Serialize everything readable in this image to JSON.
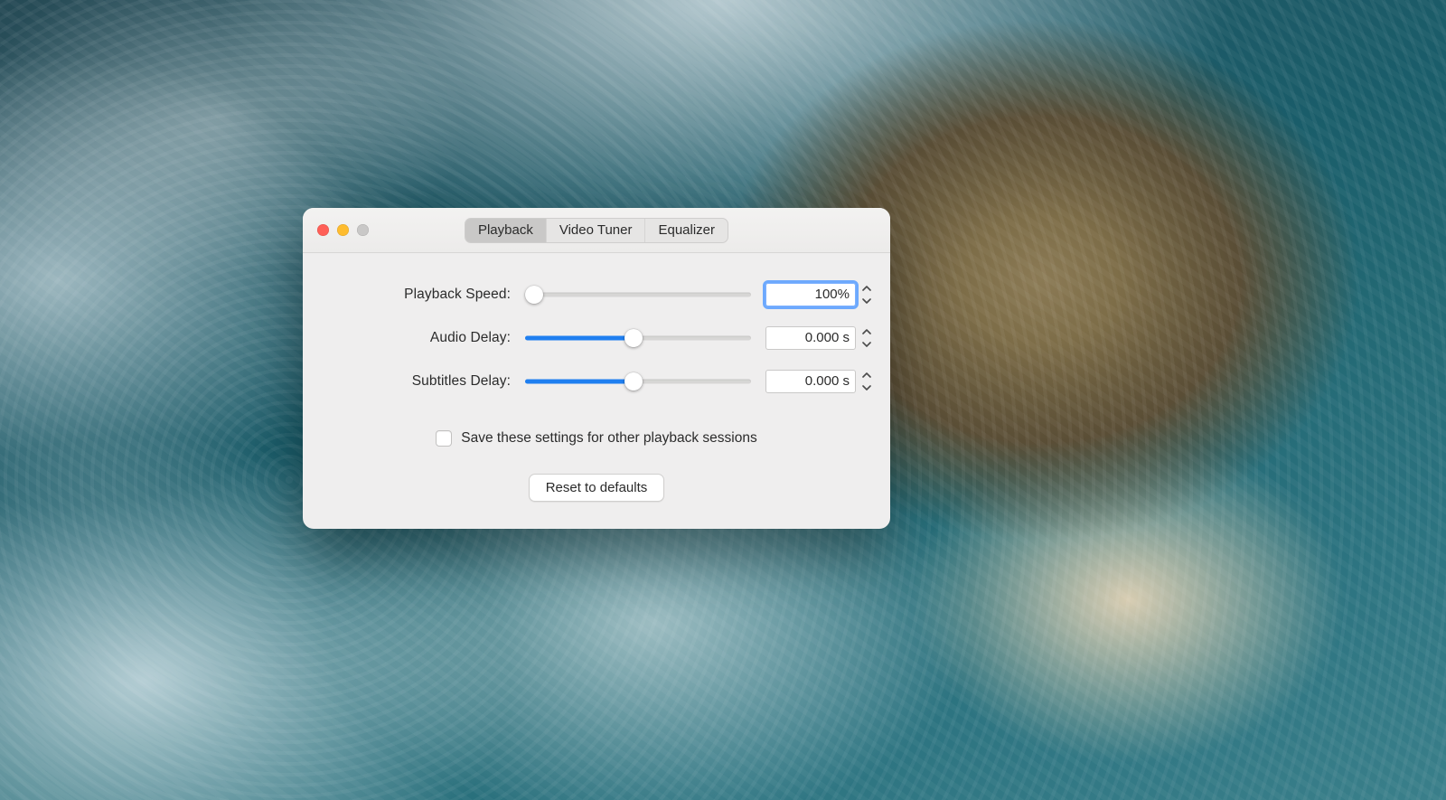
{
  "tabs": {
    "items": [
      {
        "label": "Playback",
        "active": true
      },
      {
        "label": "Video Tuner",
        "active": false
      },
      {
        "label": "Equalizer",
        "active": false
      }
    ]
  },
  "rows": {
    "playback_speed": {
      "label": "Playback Speed:",
      "value": "100%",
      "slider_percent": 4,
      "fill_percent": 0,
      "focused": true
    },
    "audio_delay": {
      "label": "Audio Delay:",
      "value": "0.000 s",
      "slider_percent": 48,
      "fill_percent": 48,
      "focused": false
    },
    "subtitles_delay": {
      "label": "Subtitles Delay:",
      "value": "0.000 s",
      "slider_percent": 48,
      "fill_percent": 48,
      "focused": false
    }
  },
  "save_checkbox": {
    "label": "Save these settings for other playback sessions",
    "checked": false
  },
  "reset_button": {
    "label": "Reset to defaults"
  },
  "colors": {
    "accent": "#1f7ff0",
    "window_bg": "#efeeee"
  }
}
